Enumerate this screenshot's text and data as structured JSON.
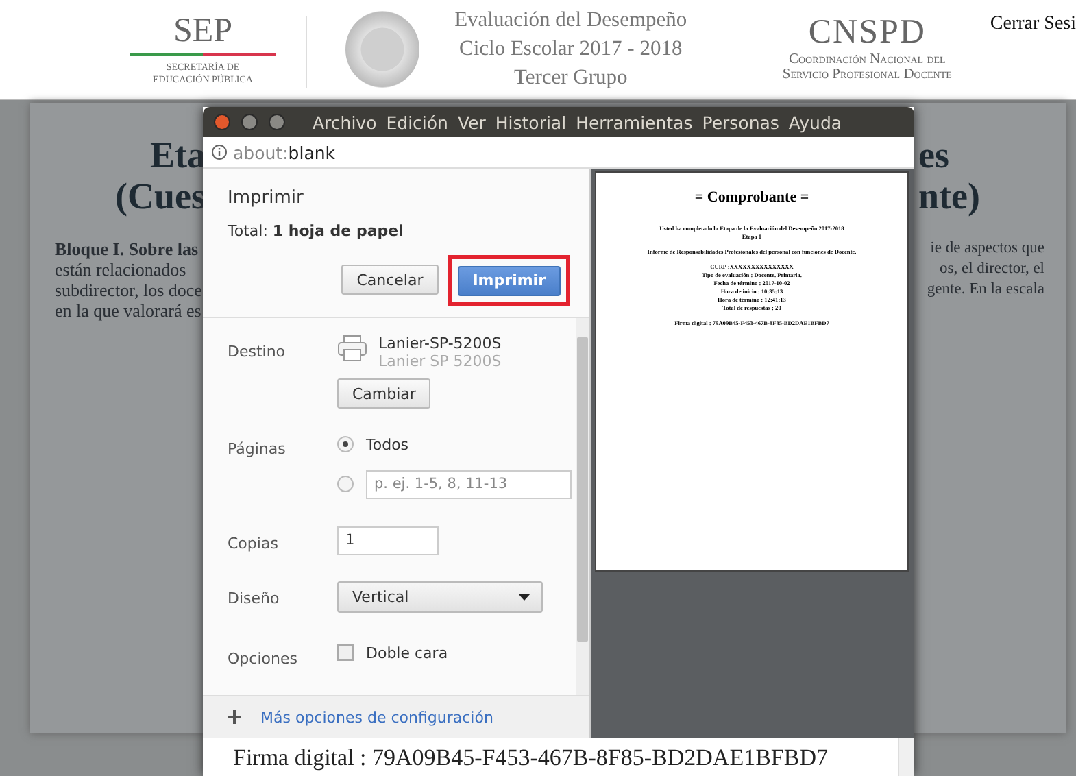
{
  "header": {
    "sep": {
      "title": "SEP",
      "lines": [
        "SECRETARÍA DE",
        "EDUCACIÓN PÚBLICA"
      ]
    },
    "title_lines": [
      "Evaluación del Desempeño",
      "Ciclo Escolar 2017 - 2018",
      "Tercer Grupo"
    ],
    "cnspd": {
      "title": "CNSPD",
      "lines": [
        "Coordinación Nacional del",
        "Servicio Profesional Docente"
      ]
    },
    "logout": "Cerrar Sesi"
  },
  "background_page": {
    "left": {
      "heading": [
        "Eta",
        "(Cues"
      ],
      "body_bold": "Bloque I. Sobre las",
      "body": [
        "están relacionados",
        "subdirector, los doce",
        "en la que valorará es"
      ]
    },
    "right": {
      "heading": [
        "es",
        "nte)"
      ],
      "body": [
        "ie de aspectos que",
        "os, el director, el",
        "gente. En la escala"
      ]
    }
  },
  "window": {
    "menu": [
      "Archivo",
      "Edición",
      "Ver",
      "Historial",
      "Herramientas",
      "Personas",
      "Ayuda"
    ],
    "url_prefix": "about:",
    "url_page": "blank",
    "print_dialog": {
      "title": "Imprimir",
      "total": "Total: **1 hoja de papel**",
      "buttons": [
        {
          "label": "Cancelar",
          "kind": "secondary",
          "highlighted": false
        },
        {
          "label": "Imprimir",
          "kind": "primary",
          "highlighted": true
        }
      ],
      "destination": {
        "label": "Destino",
        "printer": "Lanier-SP-5200S",
        "model": "Lanier SP 5200S",
        "change": "Cambiar"
      },
      "pages": {
        "label": "Páginas",
        "options": [
          {
            "kind": "all",
            "label": "Todos",
            "selected": true
          },
          {
            "kind": "range",
            "placeholder": "p. ej. 1-5, 8, 11-13",
            "selected": false
          }
        ]
      },
      "copies": {
        "label": "Copias",
        "value": "1"
      },
      "layout": {
        "label": "Diseño",
        "value": "Vertical"
      },
      "options": {
        "label": "Opciones",
        "items": [
          {
            "label": "Doble cara",
            "checked": false
          }
        ]
      },
      "more": "Más opciones de configuración",
      "preview": {
        "heading": "= Comprobante =",
        "paragraphs": [
          [
            "Usted ha completado la Etapa de la Evaluación del Desempeño 2017-2018",
            "Etapa 1"
          ],
          [
            "Informe de Responsabilidades Profesionales del personal con funciones de Docente."
          ],
          [
            "CURP :XXXXXXXXXXXXXXX",
            "Tipo de evaluación : Docente. Primaria.",
            "Fecha de término : 2017-10-02",
            "Hora de inicio : 10:35:13",
            "Hora de término : 12:41:13",
            "Total de respuestas : 20"
          ],
          [
            "Firma digital : 79A09B45-F453-467B-8F85-BD2DAE1BFBD7"
          ]
        ]
      }
    },
    "page_text": "Firma digital : 79A09B45-F453-467B-8F85-BD2DAE1BFBD7"
  }
}
